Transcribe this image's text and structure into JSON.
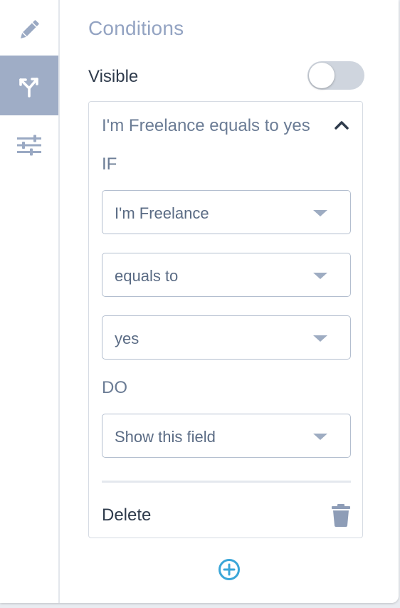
{
  "sidebar": {
    "items": [
      {
        "name": "edit",
        "icon": "pencil-icon",
        "active": false
      },
      {
        "name": "conditions",
        "icon": "branch-icon",
        "active": true
      },
      {
        "name": "settings",
        "icon": "sliders-icon",
        "active": false
      }
    ]
  },
  "panel": {
    "title": "Conditions",
    "visible_label": "Visible",
    "visible_on": false
  },
  "condition": {
    "summary": "I'm Freelance equals to yes",
    "if_label": "IF",
    "field_select": "I'm Freelance",
    "operator_select": "equals to",
    "value_select": "yes",
    "do_label": "DO",
    "action_select": "Show this field",
    "delete_label": "Delete"
  },
  "colors": {
    "accent": "#93a3c2",
    "sidebar_active": "#9fadc6",
    "add_button": "#3aa6d8"
  }
}
